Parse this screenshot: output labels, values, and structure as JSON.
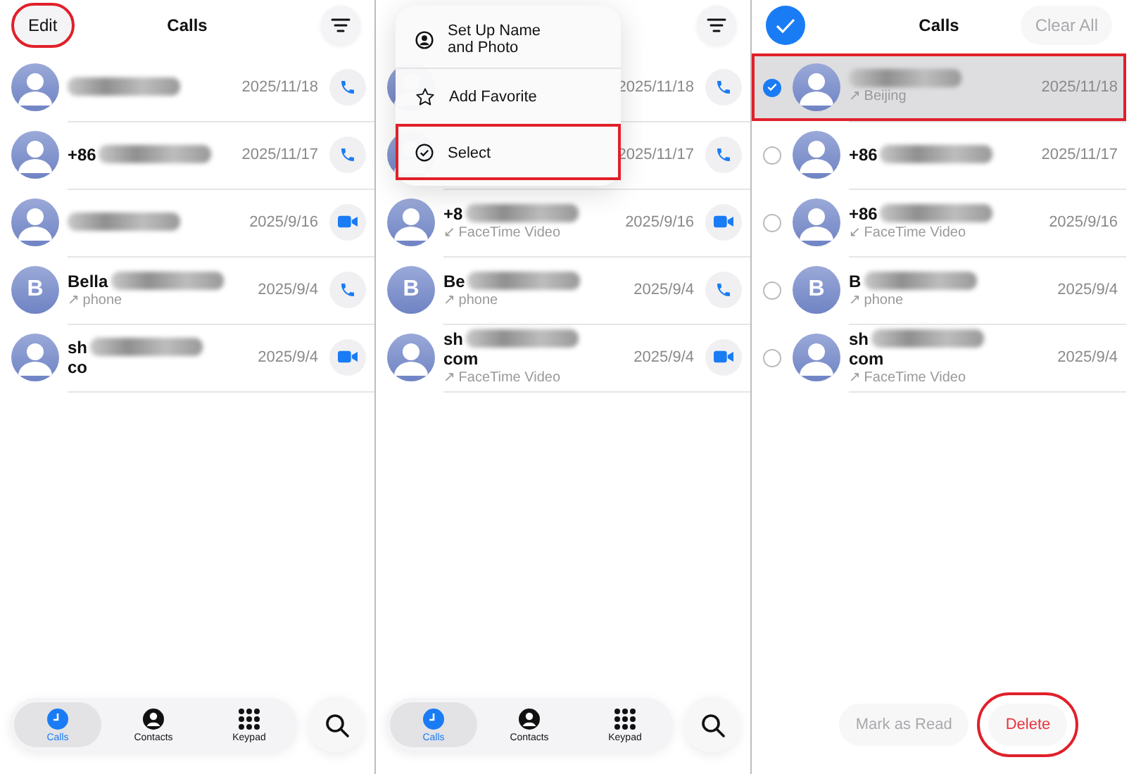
{
  "panels": [
    {
      "header": {
        "left_button": {
          "kind": "text",
          "label": "Edit",
          "highlighted": true,
          "disabled": false
        },
        "title": "Calls",
        "right_button": {
          "kind": "filter"
        }
      },
      "rows": [
        {
          "redacted": true,
          "date": "2025/11/18",
          "kind": "phone"
        },
        {
          "name_lines": [
            "+86"
          ],
          "redacted": true,
          "date": "2025/11/17",
          "kind": "phone"
        },
        {
          "redacted": true,
          "date": "2025/9/16",
          "kind": "video"
        },
        {
          "initial": "B",
          "name_lines": [
            "Bella"
          ],
          "detail": "↗ phone",
          "redacted": true,
          "date": "2025/9/4",
          "kind": "phone"
        },
        {
          "name_lines": [
            "sh",
            "co"
          ],
          "redacted": true,
          "date": "2025/9/4",
          "kind": "video"
        }
      ],
      "tab_bar": {
        "tabs": [
          {
            "label": "Calls",
            "selected": true
          },
          {
            "label": "Contacts",
            "selected": false
          },
          {
            "label": "Keypad",
            "selected": false
          }
        ]
      }
    },
    {
      "header": {
        "right_button": {
          "kind": "filter"
        }
      },
      "menu": [
        {
          "label": "Set Up Name and Photo",
          "highlighted": false
        },
        {
          "label": "Add Favorite",
          "highlighted": false
        },
        {
          "label": "Select",
          "highlighted": true
        }
      ],
      "rows": [
        {
          "date": "2025/11/18",
          "kind": "phone"
        },
        {
          "date": "2025/11/17",
          "kind": "phone"
        },
        {
          "name_lines": [
            "+8"
          ],
          "detail": "↙ FaceTime Video",
          "redacted": true,
          "date": "2025/9/16",
          "kind": "video"
        },
        {
          "initial": "B",
          "name_lines": [
            "Be"
          ],
          "detail": "↗ phone",
          "redacted": true,
          "date": "2025/9/4",
          "kind": "phone"
        },
        {
          "name_lines": [
            "sh",
            "com"
          ],
          "detail": "↗ FaceTime Video",
          "redacted": true,
          "date": "2025/9/4",
          "kind": "video"
        }
      ],
      "tab_bar": {
        "tabs": [
          {
            "label": "Calls",
            "selected": true
          },
          {
            "label": "Contacts",
            "selected": false
          },
          {
            "label": "Keypad",
            "selected": false
          }
        ]
      }
    },
    {
      "header": {
        "left_button": {
          "kind": "select_all",
          "highlighted": false
        },
        "title": "Calls",
        "right_button": {
          "kind": "text",
          "label": "Clear All",
          "disabled": true
        }
      },
      "rows": [
        {
          "selected": true,
          "highlighted": true,
          "redacted": true,
          "detail": "↗ Beijing",
          "date": "2025/11/18"
        },
        {
          "selected": false,
          "name_lines": [
            "+86"
          ],
          "redacted": true,
          "date": "2025/11/17"
        },
        {
          "selected": false,
          "name_lines": [
            "+86"
          ],
          "detail": "↙ FaceTime Video",
          "redacted": true,
          "date": "2025/9/16"
        },
        {
          "initial": "B",
          "selected": false,
          "name_lines": [
            "B"
          ],
          "detail": "↗ phone",
          "redacted": true,
          "date": "2025/9/4"
        },
        {
          "selected": false,
          "name_lines": [
            "sh",
            "com"
          ],
          "detail": "↗ FaceTime Video",
          "redacted": true,
          "date": "2025/9/4"
        }
      ],
      "actions": [
        {
          "label": "Mark as Read",
          "kind": "normal",
          "disabled": true,
          "highlighted": false
        },
        {
          "label": "Delete",
          "kind": "destructive",
          "disabled": false,
          "highlighted": true
        }
      ]
    }
  ]
}
